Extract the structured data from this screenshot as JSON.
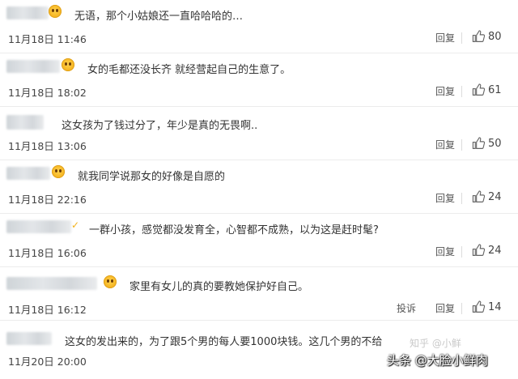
{
  "comments": [
    {
      "text": "无语，那个小姑娘还一直哈哈哈的…",
      "time": "11月18日 11:46",
      "reply": "回复",
      "likes": "80"
    },
    {
      "text": "女的毛都还没长齐 就经营起自己的生意了。",
      "time": "11月18日 18:02",
      "reply": "回复",
      "likes": "61"
    },
    {
      "text": "这女孩为了钱过分了，年少是真的无畏啊..",
      "time": "11月18日 13:06",
      "reply": "回复",
      "likes": "50"
    },
    {
      "text": "就我同学说那女的好像是自愿的",
      "time": "11月18日 22:16",
      "reply": "回复",
      "likes": "24"
    },
    {
      "text": "一群小孩，感觉都没发育全，心智都不成熟，以为这是赶时髦?",
      "time": "11月18日 16:06",
      "reply": "回复",
      "likes": "24"
    },
    {
      "text": "家里有女儿的真的要教她保护好自己。",
      "time": "11月18日 16:12",
      "report": "投诉",
      "reply": "回复",
      "likes": "14"
    },
    {
      "text": "这女的发出来的，为了跟5个男的每人要1000块钱。这几个男的不给",
      "time": "11月20日 20:00"
    }
  ],
  "watermark": {
    "zhihu": "知乎 @小鲜",
    "main": "头条 @大脸小鲜肉"
  },
  "colors": {
    "like_icon": "#666666",
    "badge": "#f5b21f"
  },
  "icons": {
    "like": "thumbs-up-icon",
    "badge": "emoji-badge-icon"
  }
}
